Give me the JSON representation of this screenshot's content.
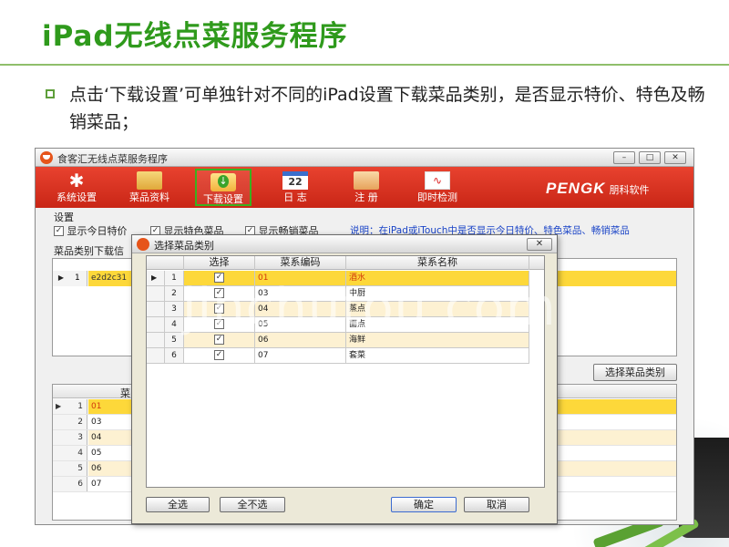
{
  "slide": {
    "title": "iPad无线点菜服务程序",
    "bullet_text": "点击‘下载设置’可单独针对不同的iPad设置下载菜品类别，是否显示特价、特色及畅销菜品；"
  },
  "app": {
    "window_title": "食客汇无线点菜服务程序",
    "window_buttons": {
      "minimize": "–",
      "maximize": "□",
      "close": "✕"
    },
    "toolbar": [
      {
        "label": "系统设置",
        "icon": "gear-icon"
      },
      {
        "label": "菜品资料",
        "icon": "folder-icon"
      },
      {
        "label": "下载设置",
        "icon": "download-icon",
        "selected": true
      },
      {
        "label": "日 志",
        "icon": "calendar-icon",
        "icon_text": "22"
      },
      {
        "label": "注 册",
        "icon": "user-card-icon"
      },
      {
        "label": "即时检测",
        "icon": "pulse-monitor-icon"
      }
    ],
    "brand": {
      "name": "PENGK",
      "sub": "朋科软件"
    },
    "settings": {
      "label": "设置",
      "options": [
        {
          "label": "显示今日特价",
          "checked": true
        },
        {
          "label": "显示特色菜品",
          "checked": true
        },
        {
          "label": "显示畅销菜品",
          "checked": true
        }
      ],
      "note": "说明：在iPad或iTouch中是否显示今日特价、特色菜品、畅销菜品"
    },
    "device_panel": {
      "label": "菜品类别下载信",
      "rows": [
        {
          "num": "1",
          "value": "e2d2c31"
        }
      ]
    },
    "select_button": "选择菜品类别",
    "category_panel": {
      "header": "菜",
      "rows": [
        {
          "num": "1",
          "code": "01"
        },
        {
          "num": "2",
          "code": "03"
        },
        {
          "num": "3",
          "code": "04"
        },
        {
          "num": "4",
          "code": "05"
        },
        {
          "num": "5",
          "code": "06"
        },
        {
          "num": "6",
          "code": "07"
        }
      ]
    }
  },
  "dialog": {
    "title": "选择菜品类别",
    "close": "✕",
    "columns": {
      "select": "选择",
      "code": "菜系编码",
      "name": "菜系名称"
    },
    "rows": [
      {
        "num": "1",
        "checked": true,
        "code": "01",
        "name": "酒水"
      },
      {
        "num": "2",
        "checked": true,
        "code": "03",
        "name": "中厨"
      },
      {
        "num": "3",
        "checked": true,
        "code": "04",
        "name": "蒸点"
      },
      {
        "num": "4",
        "checked": true,
        "code": "05",
        "name": "面点"
      },
      {
        "num": "5",
        "checked": true,
        "code": "06",
        "name": "海鲜"
      },
      {
        "num": "6",
        "checked": true,
        "code": "07",
        "name": "套菜"
      }
    ],
    "buttons": {
      "select_all": "全选",
      "select_none": "全不选",
      "ok": "确定",
      "cancel": "取消"
    }
  },
  "watermark": "jinchutou.com",
  "colors": {
    "title_green": "#2f9a1c",
    "toolbar_red": "#d8301f",
    "highlight_yellow": "#fdd83a",
    "note_blue": "#1a44c7"
  }
}
